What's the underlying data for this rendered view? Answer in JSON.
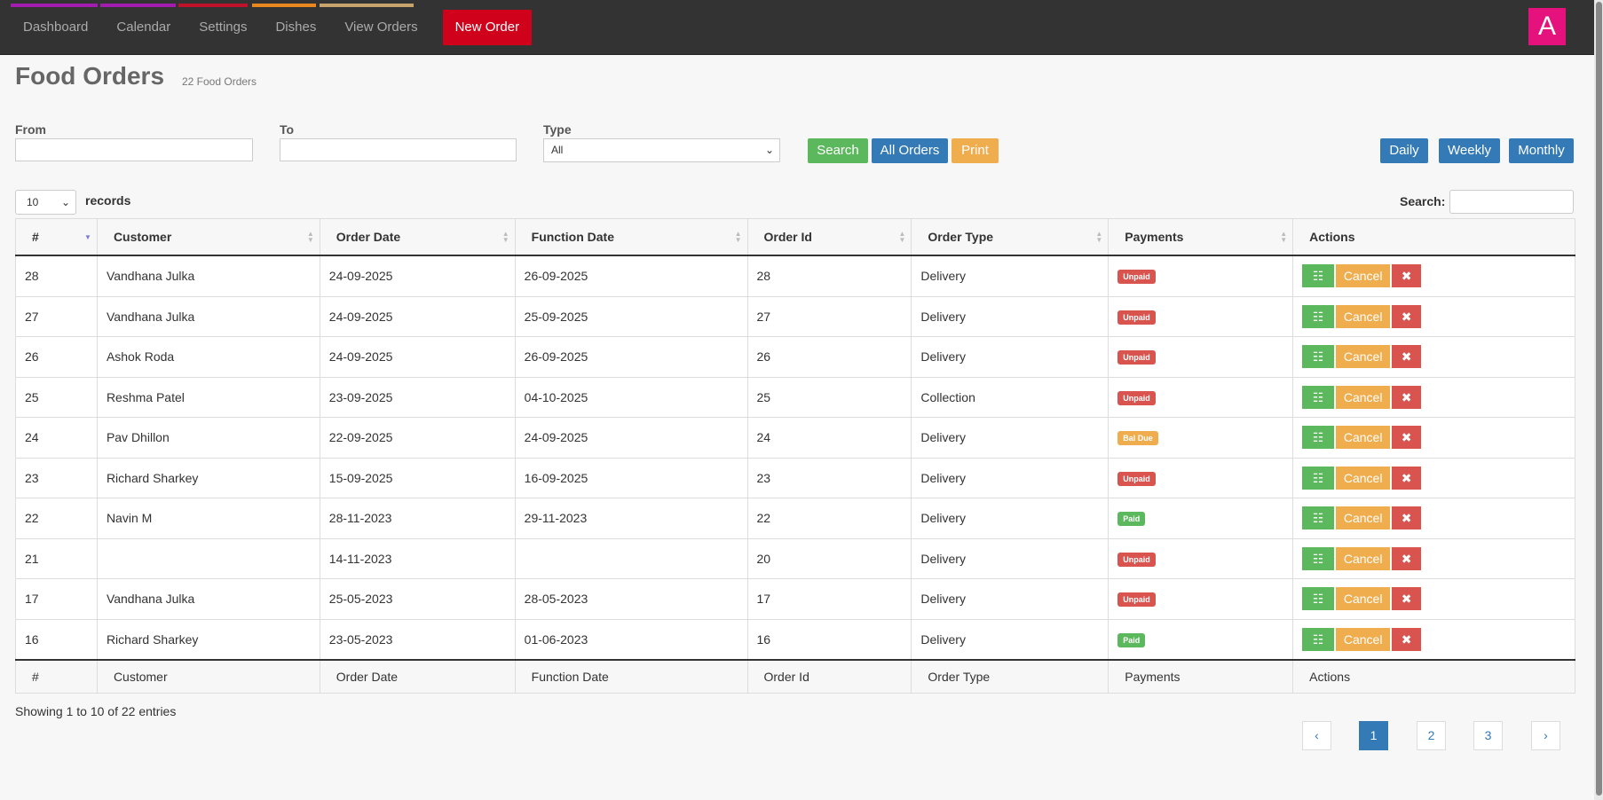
{
  "nav": {
    "items": [
      "Dashboard",
      "Calendar",
      "Settings",
      "Dishes",
      "View Orders"
    ],
    "new_order": "New Order",
    "avatar_letter": "A",
    "strip_colors": [
      "#a21caf",
      "#a21caf",
      "#c0132b",
      "#e8871e",
      "#c8a26b"
    ]
  },
  "page": {
    "title": "Food Orders",
    "count": "22 Food Orders"
  },
  "filters": {
    "from_label": "From",
    "from_value": "",
    "to_label": "To",
    "to_value": "",
    "type_label": "Type",
    "type_value": "All",
    "search_btn": "Search",
    "all_orders_btn": "All Orders",
    "print_btn": "Print",
    "daily_btn": "Daily",
    "weekly_btn": "Weekly",
    "monthly_btn": "Monthly"
  },
  "table_controls": {
    "page_length": "10",
    "records_label": "records",
    "search_label": "Search:",
    "search_value": ""
  },
  "columns": [
    "#",
    "Customer",
    "Order Date",
    "Function Date",
    "Order Id",
    "Order Type",
    "Payments",
    "Actions"
  ],
  "rows": [
    {
      "num": "28",
      "customer": "Vandhana Julka",
      "order_date": "24-09-2025",
      "function_date": "26-09-2025",
      "order_id": "28",
      "type": "Delivery",
      "payment": "Unpaid"
    },
    {
      "num": "27",
      "customer": "Vandhana Julka",
      "order_date": "24-09-2025",
      "function_date": "25-09-2025",
      "order_id": "27",
      "type": "Delivery",
      "payment": "Unpaid"
    },
    {
      "num": "26",
      "customer": "Ashok Roda",
      "order_date": "24-09-2025",
      "function_date": "26-09-2025",
      "order_id": "26",
      "type": "Delivery",
      "payment": "Unpaid"
    },
    {
      "num": "25",
      "customer": "Reshma Patel",
      "order_date": "23-09-2025",
      "function_date": "04-10-2025",
      "order_id": "25",
      "type": "Collection",
      "payment": "Unpaid"
    },
    {
      "num": "24",
      "customer": "Pav Dhillon",
      "order_date": "22-09-2025",
      "function_date": "24-09-2025",
      "order_id": "24",
      "type": "Delivery",
      "payment": "Bal Due"
    },
    {
      "num": "23",
      "customer": "Richard Sharkey",
      "order_date": "15-09-2025",
      "function_date": "16-09-2025",
      "order_id": "23",
      "type": "Delivery",
      "payment": "Unpaid"
    },
    {
      "num": "22",
      "customer": "Navin M",
      "order_date": "28-11-2023",
      "function_date": "29-11-2023",
      "order_id": "22",
      "type": "Delivery",
      "payment": "Paid"
    },
    {
      "num": "21",
      "customer": "",
      "order_date": "14-11-2023",
      "function_date": "",
      "order_id": "20",
      "type": "Delivery",
      "payment": "Unpaid"
    },
    {
      "num": "17",
      "customer": "Vandhana Julka",
      "order_date": "25-05-2023",
      "function_date": "28-05-2023",
      "order_id": "17",
      "type": "Delivery",
      "payment": "Unpaid"
    },
    {
      "num": "16",
      "customer": "Richard Sharkey",
      "order_date": "23-05-2023",
      "function_date": "01-06-2023",
      "order_id": "16",
      "type": "Delivery",
      "payment": "Paid"
    }
  ],
  "payment_colors": {
    "Unpaid": "#d9534f",
    "Bal Due": "#f0ad4e",
    "Paid": "#5cb85c"
  },
  "actions": {
    "cancel_label": "Cancel",
    "delete_glyph": "✖",
    "view_glyph": "☷"
  },
  "footer": {
    "info": "Showing 1 to 10 of 22 entries",
    "pages": [
      "1",
      "2",
      "3"
    ],
    "prev_glyph": "‹",
    "next_glyph": "›"
  }
}
